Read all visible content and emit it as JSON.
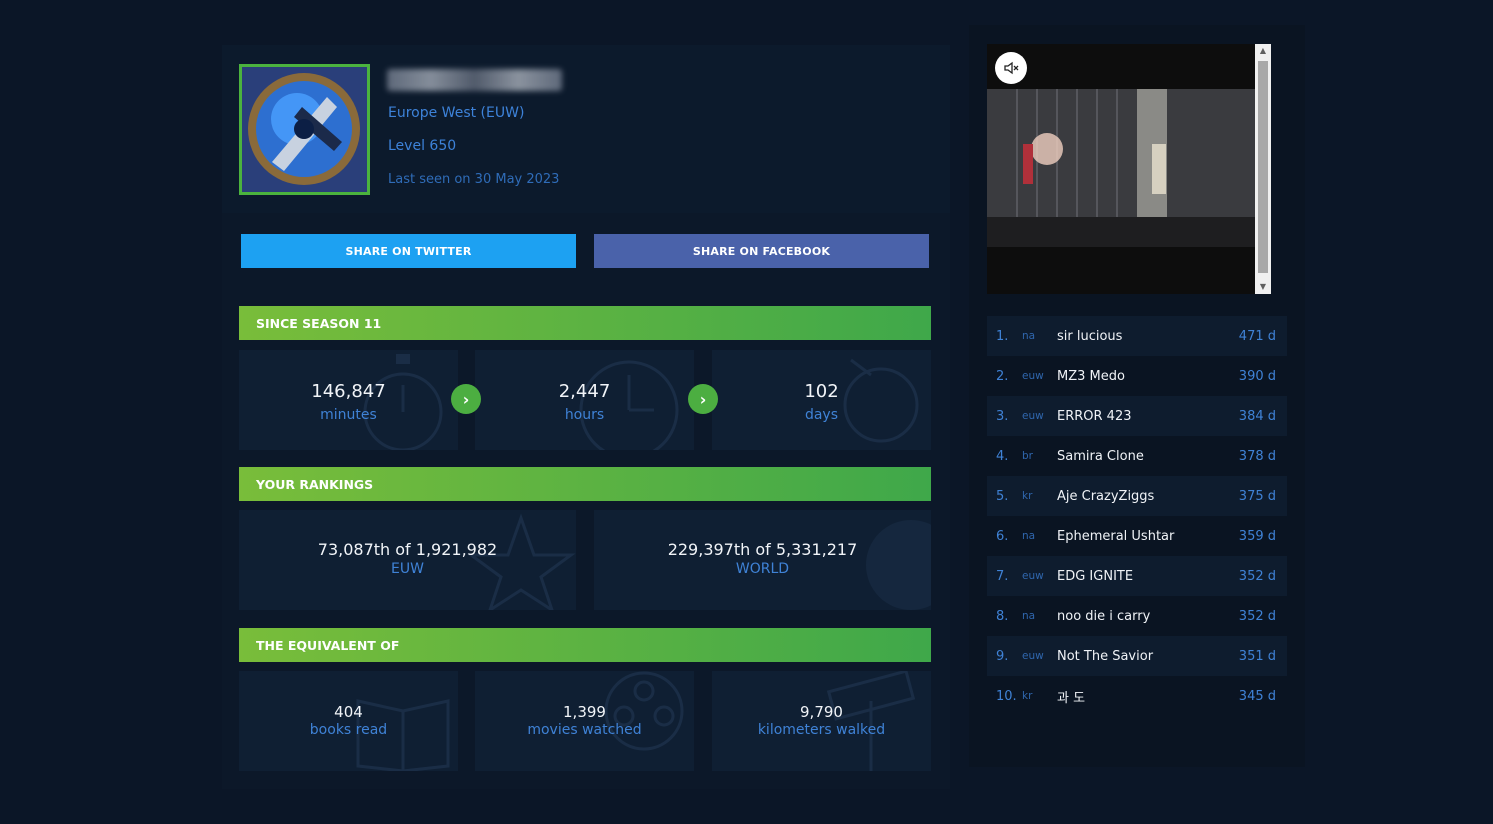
{
  "profile": {
    "region": "Europe West (EUW)",
    "level": "Level 650",
    "last_seen": "Last seen on 30 May 2023"
  },
  "share": {
    "twitter": "SHARE ON TWITTER",
    "facebook": "SHARE ON FACEBOOK"
  },
  "season": {
    "title": "SINCE SEASON 11",
    "minutes_value": "146,847",
    "minutes_label": "minutes",
    "hours_value": "2,447",
    "hours_label": "hours",
    "days_value": "102",
    "days_label": "days"
  },
  "rankings": {
    "title": "YOUR RANKINGS",
    "region_value": "73,087th of 1,921,982",
    "region_label": "EUW",
    "world_value": "229,397th of 5,331,217",
    "world_label": "WORLD"
  },
  "equivalent": {
    "title": "THE EQUIVALENT OF",
    "books_value": "404",
    "books_label": "books read",
    "movies_value": "1,399",
    "movies_label": "movies watched",
    "km_value": "9,790",
    "km_label": "kilometers walked"
  },
  "icons": {
    "next": "chevron-right",
    "mute": "speaker-muted",
    "scroll_up": "▲",
    "scroll_down": "▼"
  },
  "leaderboard": [
    {
      "pos": "1.",
      "region": "na",
      "name": "sir lucious",
      "days": "471 d"
    },
    {
      "pos": "2.",
      "region": "euw",
      "name": "MZ3 Medo",
      "days": "390 d"
    },
    {
      "pos": "3.",
      "region": "euw",
      "name": "ERROR 423",
      "days": "384 d"
    },
    {
      "pos": "4.",
      "region": "br",
      "name": "Samira Clone",
      "days": "378 d"
    },
    {
      "pos": "5.",
      "region": "kr",
      "name": "Aje CrazyZiggs",
      "days": "375 d"
    },
    {
      "pos": "6.",
      "region": "na",
      "name": "Ephemeral Ushtar",
      "days": "359 d"
    },
    {
      "pos": "7.",
      "region": "euw",
      "name": "EDG IGNITE",
      "days": "352 d"
    },
    {
      "pos": "8.",
      "region": "na",
      "name": "noo die i carry",
      "days": "352 d"
    },
    {
      "pos": "9.",
      "region": "euw",
      "name": "Not The Savior",
      "days": "351 d"
    },
    {
      "pos": "10.",
      "region": "kr",
      "name": "과 도",
      "days": "345 d"
    }
  ],
  "colors": {
    "background": "#0b1627",
    "accent_green": "#4cae41",
    "accent_blue": "#3f82d6",
    "twitter": "#1da1f2",
    "facebook": "#4a62aa"
  }
}
